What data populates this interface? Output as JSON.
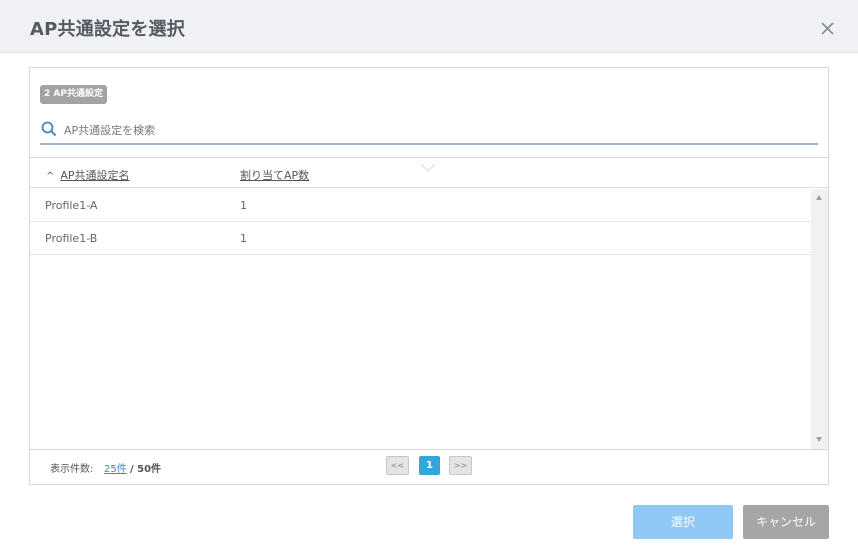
{
  "dialog": {
    "title": "AP共通設定を選択",
    "close_icon": "close-icon"
  },
  "panel": {
    "badge": "2 AP共通設定",
    "search": {
      "placeholder": "AP共通設定を検索",
      "value": "",
      "icon": "search-icon"
    },
    "table": {
      "sort_icon": "^",
      "columns": [
        "AP共通設定名",
        "割り当てAP数"
      ],
      "rows": [
        {
          "name": "Profile1-A",
          "count": "1"
        },
        {
          "name": "Profile1-B",
          "count": "1"
        }
      ]
    },
    "footer": {
      "display_count_label": "表示件数:",
      "page_size": "25件",
      "total": "/ 50件",
      "prev": "<<",
      "current_page": "1",
      "next": ">>"
    }
  },
  "actions": {
    "select_label": "選択",
    "cancel_label": "キャンセル"
  },
  "colors": {
    "accent": "#35a6d9",
    "select_button": "#8ec8f3",
    "cancel_button": "#a6a6a6",
    "header_bg": "#f0f1f4"
  }
}
